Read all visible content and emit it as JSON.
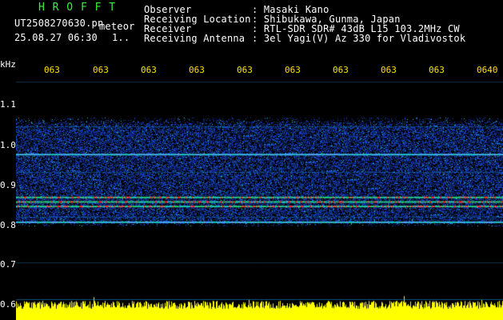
{
  "header": {
    "app_name": "H R O F F T",
    "file_label": "UT2508270630.pn",
    "mode_label": "meteor",
    "timestamp": "25.08.27 06:30",
    "index": "1..",
    "info": [
      {
        "label": "Observer",
        "value": ": Masaki Kano"
      },
      {
        "label": "Receiving Location",
        "value": ": Shibukawa, Gunma, Japan"
      },
      {
        "label": "Receiver",
        "value": ": RTL-SDR SDR# 43dB L15 103.2MHz CW"
      },
      {
        "label": "Receiving Antenna",
        "value": ": 3el Yagi(V) Az 330 for Vladivostok"
      }
    ]
  },
  "axes": {
    "y_unit": "kHz",
    "y_ticks": [
      "1.1",
      "1.0",
      "0.9",
      "0.8",
      "0.7",
      "0.6"
    ],
    "x_ticks": [
      "063",
      "063",
      "063",
      "063",
      "063",
      "063",
      "063",
      "063",
      "063",
      "0640"
    ]
  },
  "chart_data": {
    "type": "heatmap",
    "ylabel": "kHz",
    "ylim": [
      0.6,
      1.1
    ],
    "yticks": [
      1.1,
      1.0,
      0.9,
      0.8,
      0.7,
      0.6
    ],
    "xtick_labels": [
      "063",
      "063",
      "063",
      "063",
      "063",
      "063",
      "063",
      "063",
      "063",
      "0640"
    ],
    "signal_band_khz": [
      0.78,
      1.02
    ],
    "strong_lines_khz": [
      0.825,
      0.835,
      0.845,
      0.79,
      0.94
    ],
    "colors": {
      "background": "#000000",
      "noise": "#1840c8",
      "mid": "#19c8c0",
      "strong": "#ff2a2a",
      "amplitude": "#ffff00",
      "grid": "#1a8fd6"
    }
  }
}
